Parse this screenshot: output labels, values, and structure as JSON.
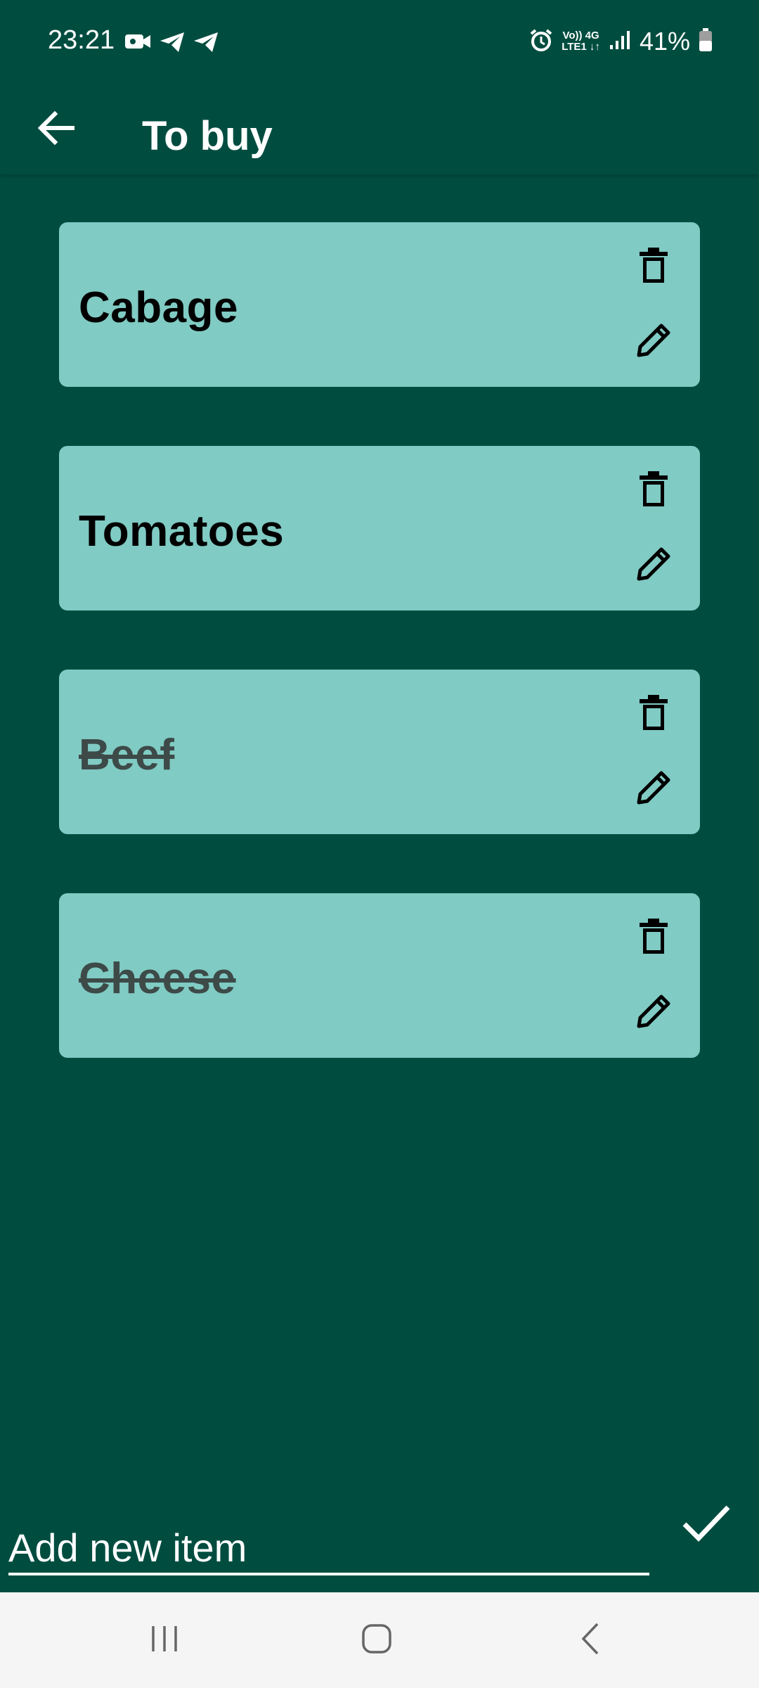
{
  "status_bar": {
    "time": "23:21",
    "network_top": "Vo)) 4G",
    "network_bottom": "LTE1 ↓↑",
    "battery": "41%",
    "left_icons": [
      "video-icon",
      "telegram-icon",
      "telegram-icon"
    ],
    "right_icons": [
      "alarm-icon",
      "signal-icon",
      "battery-icon"
    ]
  },
  "app_bar": {
    "title": "To buy",
    "back_icon": "arrow-back-icon"
  },
  "items": [
    {
      "label": "Cabage",
      "checked": false
    },
    {
      "label": "Tomatoes",
      "checked": false
    },
    {
      "label": "Beef",
      "checked": true
    },
    {
      "label": "Cheese",
      "checked": true
    }
  ],
  "add_item": {
    "placeholder": "Add new item",
    "value": "",
    "confirm_icon": "check-icon"
  },
  "colors": {
    "background": "#004d40",
    "card": "#80cbc4",
    "text_primary": "#000000",
    "text_done": "#3d4a48",
    "nav_bar": "#f5f5f5"
  },
  "nav_bar": {
    "icons": [
      "recents-icon",
      "home-icon",
      "back-nav-icon"
    ]
  }
}
